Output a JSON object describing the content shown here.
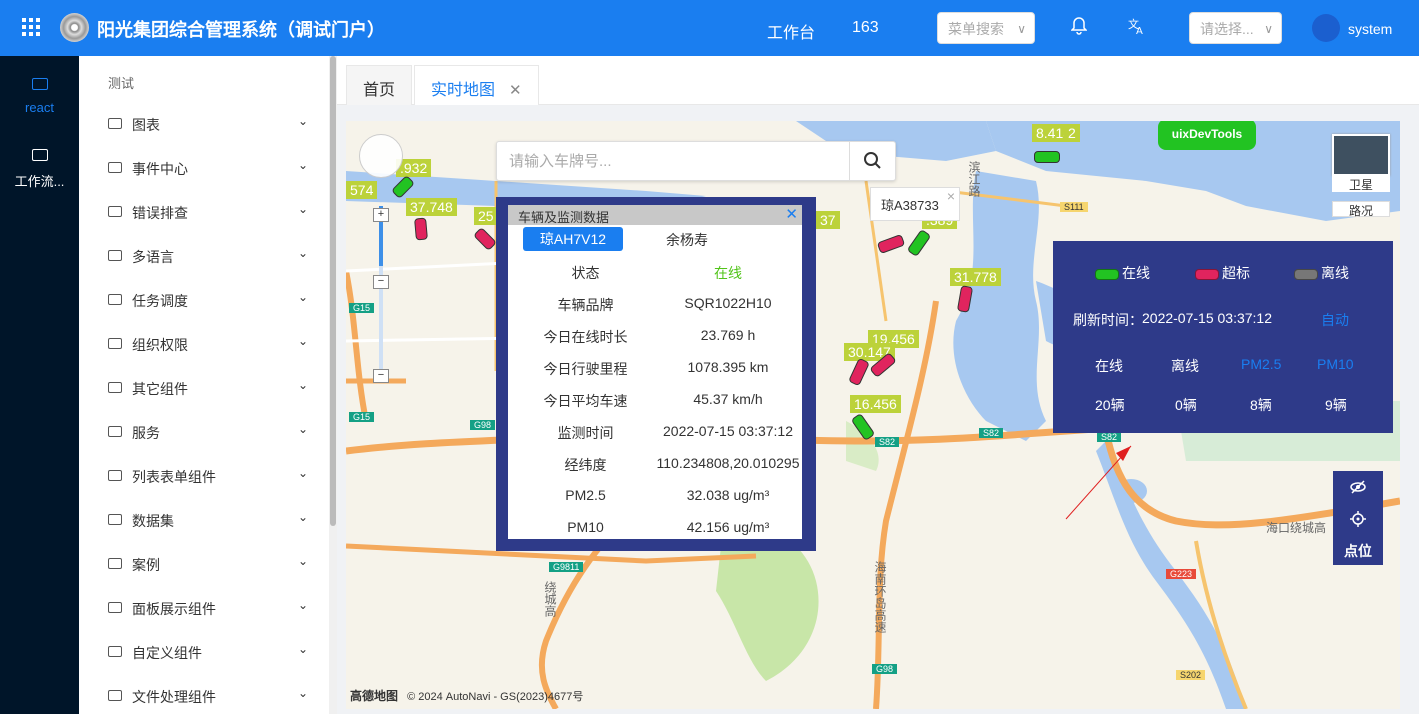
{
  "header": {
    "app_title": "阳光集团综合管理系统（调试门户）",
    "workbench": "工作台",
    "count": "163",
    "menu_search_placeholder": "菜单搜索",
    "select_placeholder": "请选择...",
    "username": "system",
    "bg_color": "#1a7ef0"
  },
  "left_rail": {
    "items": [
      {
        "label": "react",
        "icon": "folder-icon"
      },
      {
        "label": "工作流...",
        "icon": "folder-icon"
      }
    ]
  },
  "sidebar": {
    "header": "测试",
    "items": [
      {
        "label": "图表"
      },
      {
        "label": "事件中心"
      },
      {
        "label": "错误排查"
      },
      {
        "label": "多语言"
      },
      {
        "label": "任务调度"
      },
      {
        "label": "组织权限"
      },
      {
        "label": "其它组件"
      },
      {
        "label": "服务"
      },
      {
        "label": "列表表单组件"
      },
      {
        "label": "数据集"
      },
      {
        "label": "案例"
      },
      {
        "label": "面板展示组件"
      },
      {
        "label": "自定义组件"
      },
      {
        "label": "文件处理组件"
      }
    ]
  },
  "tabs": [
    {
      "label": "首页",
      "active": false
    },
    {
      "label": "实时地图",
      "active": true
    }
  ],
  "map": {
    "search_placeholder": "请输入车牌号...",
    "devtools": "uixDevTools",
    "satellite": "卫星",
    "traffic": "路况",
    "tooltip_plate": "琼A38733",
    "car_labels": [
      "8.415",
      "2",
      ".932",
      "574",
      "37.748",
      "25",
      "37",
      "31.778",
      "19.456",
      "30.147",
      "16.456",
      ".389"
    ],
    "road_labels": [
      "G15",
      "G15",
      "G98",
      "S111",
      "S82",
      "S82",
      "S82",
      "G9811",
      "G223",
      "G98",
      "S202"
    ],
    "place_labels": [
      "滨江路",
      "海口绕城高",
      "海南环岛高速",
      "绕城高"
    ],
    "copyright": "© 2024 AutoNavi - GS(2023)4677号",
    "amap_logo": "高德地图"
  },
  "popup": {
    "title": "车辆及监测数据",
    "plate": "琼AH7V12",
    "driver": "余杨寿",
    "rows": [
      {
        "key": "状态",
        "value": "在线"
      },
      {
        "key": "车辆品牌",
        "value": "SQR1022H10"
      },
      {
        "key": "今日在线时长",
        "value": "23.769 h"
      },
      {
        "key": "今日行驶里程",
        "value": "1078.395 km"
      },
      {
        "key": "今日平均车速",
        "value": "45.37 km/h"
      },
      {
        "key": "监测时间",
        "value": "2022-07-15 03:37:12"
      },
      {
        "key": "经纬度",
        "value": "110.234808,20.010295"
      },
      {
        "key": "PM2.5",
        "value": "32.038 ug/m³"
      },
      {
        "key": "PM10",
        "value": "42.156 ug/m³"
      }
    ],
    "online_color": "#52c41a"
  },
  "stats": {
    "legend": [
      {
        "label": "在线",
        "color": "#22c322"
      },
      {
        "label": "超标",
        "color": "#e0245e"
      },
      {
        "label": "离线",
        "color": "#777777"
      }
    ],
    "refresh_label": "刷新时间：",
    "refresh_time": "2022-07-15 03:37:12",
    "auto": "自动",
    "columns": [
      {
        "label": "在线",
        "value": "20辆"
      },
      {
        "label": "离线",
        "value": "0辆"
      },
      {
        "label": "PM2.5",
        "value": "8辆"
      },
      {
        "label": "PM10",
        "value": "9辆"
      }
    ]
  },
  "tool": {
    "label": "点位"
  }
}
